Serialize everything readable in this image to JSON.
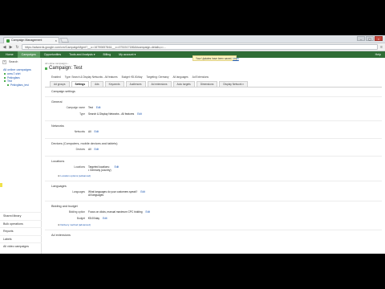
{
  "browser": {
    "tab_title": "Campaign Management",
    "tab_close": "×",
    "window_controls": [
      "–",
      "▢",
      "×"
    ],
    "url": "https://adwords.google.com/cm/CampaignMgmt?__u=1679065784&__c=4751517186&#campaign-details;c=…",
    "back": "◀",
    "forward": "▶",
    "reload": "↻",
    "menu": "≡"
  },
  "appnav": {
    "items": [
      "Home",
      "Campaigns",
      "Opportunities",
      "Tools and Analysis ▾",
      "Billing",
      "My account ▾"
    ],
    "active_index": 1,
    "help": "Help"
  },
  "notice": {
    "text": "Your Updates have been saved.",
    "link": "Undo"
  },
  "sidebar": {
    "search": "Search",
    "title": "All online campaigns",
    "tree": [
      {
        "label": "www.T-shirt",
        "sub": false
      },
      {
        "label": "Pekingfans",
        "sub": false
      },
      {
        "label": "Test",
        "sub": false
      },
      {
        "label": "Pekingfans_test",
        "sub": true
      }
    ],
    "bottom": [
      "Shared library",
      "Bulk operations",
      "Reports",
      "Labels",
      "All video campaigns"
    ]
  },
  "main": {
    "breadcrumb": "All online campaigns ›",
    "title": "Campaign: Test",
    "status": [
      "Enabled",
      "Type: Search & Display Networks - All features",
      "Budget: €5.00/day",
      "Targeting: Germany",
      "All languages",
      "Ad Extensions"
    ],
    "tabs": [
      "Ad groups",
      "Settings",
      "Ads",
      "Keywords",
      "Audiences",
      "Ad extensions",
      "Auto targets",
      "Dimensions",
      "Display Network ▾"
    ],
    "active_tab": 1,
    "settings_heading": "Campaign settings",
    "sections": [
      {
        "head": "General",
        "rows": [
          {
            "label": "Campaign name",
            "value": "Test",
            "edit": "Edit"
          },
          {
            "label": "Type",
            "value": "Search & Display Networks - All features",
            "edit": "Edit"
          }
        ]
      },
      {
        "head": "Networks",
        "rows": [
          {
            "label": "Networks",
            "value": "All",
            "edit": "Edit"
          }
        ]
      },
      {
        "head": "Devices (Computers, mobile devices and tablets)",
        "rows": [
          {
            "label": "Devices",
            "value": "All",
            "edit": "Edit"
          }
        ]
      },
      {
        "head": "Locations",
        "rows": [
          {
            "label": "Locations",
            "value": "Targeted locations:\n• Germany (country)",
            "edit": "Edit"
          }
        ],
        "more": "Location options (advanced)"
      },
      {
        "head": "Languages",
        "rows": [
          {
            "label": "Languages",
            "value": "What languages do your customers speak?\nAll languages",
            "edit": "Edit"
          }
        ]
      },
      {
        "head": "Bidding and budget",
        "rows": [
          {
            "label": "Bidding option",
            "value": "Focus on clicks, manual maximum CPC bidding",
            "edit": "Edit"
          },
          {
            "label": "Budget",
            "value": "€5.00/day",
            "edit": "Edit"
          }
        ],
        "more": "Delivery method (advanced)"
      },
      {
        "head": "Ad extensions",
        "rows": []
      }
    ]
  }
}
